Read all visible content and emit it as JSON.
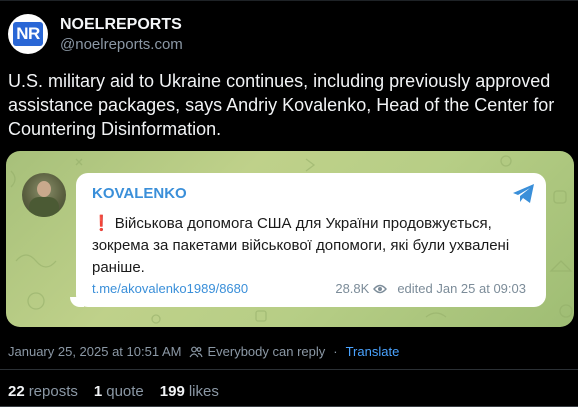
{
  "author": {
    "avatar_text": "NR",
    "display_name": "NOELREPORTS",
    "handle": "@noelreports.com"
  },
  "post": {
    "text": "U.S. military aid to Ukraine continues, including previously approved assistance packages, says Andriy Kovalenko, Head of the Center for Countering Disinformation."
  },
  "embed": {
    "channel_name": "KOVALENKO",
    "exclamation": "❗",
    "message": "Військова допомога США для України продовжується, зокрема за пакетами військової допомоги, які були ухвалені раніше.",
    "link": "t.me/akovalenko1989/8680",
    "views": "28.8K",
    "edited": "edited  Jan 25 at 09:03",
    "icons": {
      "plane": "telegram-icon",
      "eye": "eye-icon"
    },
    "colors": {
      "link": "#3a8fd9",
      "background": "#b7ce86"
    }
  },
  "meta": {
    "timestamp": "January 25, 2025 at 10:51 AM",
    "reply_setting": "Everybody can reply",
    "dot": "·",
    "translate": "Translate"
  },
  "stats": {
    "reposts_count": "22",
    "reposts_label": "reposts",
    "quotes_count": "1",
    "quotes_label": "quote",
    "likes_count": "199",
    "likes_label": "likes"
  },
  "colors": {
    "accent": "#4aa3ff",
    "muted": "#8b98a5",
    "background": "#000000"
  }
}
